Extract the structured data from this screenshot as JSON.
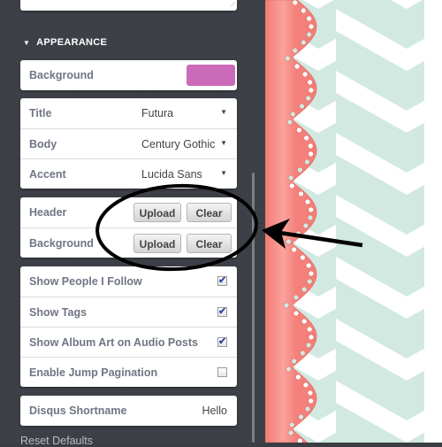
{
  "colors": {
    "sidebar_bg": "#3b3f45",
    "background_swatch": "#cb6ab8",
    "ribbon": "#f4827c",
    "chevron": "#d1e9e1",
    "checkbox_check": "#3346a0"
  },
  "appearance": {
    "section_title": "APPEARANCE",
    "background_color": {
      "label": "Background",
      "value_color": "#cb6ab8"
    },
    "fonts": [
      {
        "label": "Title",
        "value": "Futura"
      },
      {
        "label": "Body",
        "value": "Century Gothic"
      },
      {
        "label": "Accent",
        "value": "Lucida Sans"
      }
    ],
    "images": [
      {
        "label": "Header",
        "upload_label": "Upload",
        "clear_label": "Clear"
      },
      {
        "label": "Background",
        "upload_label": "Upload",
        "clear_label": "Clear"
      }
    ],
    "toggles": [
      {
        "label": "Show People I Follow",
        "checked": true
      },
      {
        "label": "Show Tags",
        "checked": true
      },
      {
        "label": "Show Album Art on Audio Posts",
        "checked": true
      },
      {
        "label": "Enable Jump Pagination",
        "checked": false
      }
    ],
    "disqus": {
      "label": "Disqus Shortname",
      "value": "Hello"
    },
    "reset_label": "Reset Defaults"
  },
  "icons": {
    "caret": "▼",
    "section_toggle": "▼",
    "check": "✔"
  }
}
